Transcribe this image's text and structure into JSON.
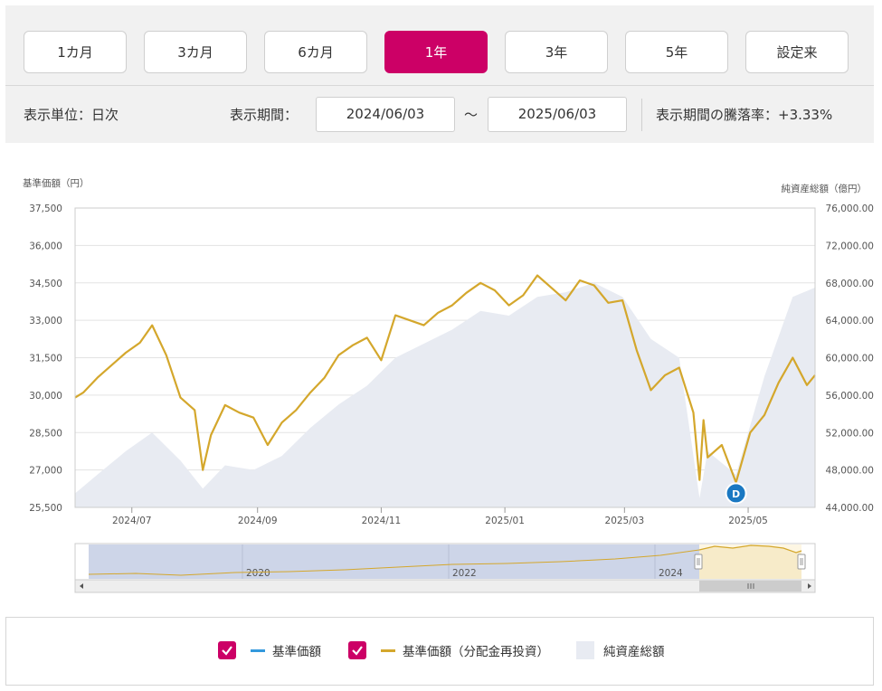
{
  "periods": [
    "1カ月",
    "3カ月",
    "6カ月",
    "1年",
    "3年",
    "5年",
    "設定来"
  ],
  "active_period": "1年",
  "display_unit": "表示単位：日次",
  "display_range_label": "表示期間：",
  "start_date": "2024/06/03",
  "range_sep": "～",
  "end_date": "2025/06/03",
  "change_rate": "表示期間の騰落率：+3.33%",
  "legend": {
    "nav": "基準価額",
    "nav_reinvested": "基準価額（分配金再投資）",
    "net_assets": "純資産総額"
  },
  "colors": {
    "accent": "#cc0066",
    "nav_line": "#3399dd",
    "reinvested_line": "#d4a72c",
    "area": "#e8ebf2",
    "dividend_marker": "#1a78c2"
  },
  "chart_data": {
    "type": "line",
    "left_axis_title": "基準価額（円）",
    "right_axis_title": "純資産総額（億円）",
    "left_ticks": [
      "37,500",
      "36,000",
      "34,500",
      "33,000",
      "31,500",
      "30,000",
      "28,500",
      "27,000",
      "25,500"
    ],
    "right_ticks": [
      "76,000.00",
      "72,000.00",
      "68,000.00",
      "64,000.00",
      "60,000.00",
      "56,000.00",
      "52,000.00",
      "48,000.00",
      "44,000.00"
    ],
    "x_ticks": [
      "2024/07",
      "2024/09",
      "2024/11",
      "2025/01",
      "2025/03",
      "2025/05"
    ],
    "x_tick_positions": [
      "2024-07-01",
      "2024-09-01",
      "2024-11-01",
      "2025-01-01",
      "2025-03-01",
      "2025-05-01"
    ],
    "x_range": [
      "2024-06-03",
      "2025-06-03"
    ],
    "ylim_left": [
      25500,
      37500
    ],
    "ylim_right": [
      44000,
      76000
    ],
    "grid": true,
    "dividend_marker": {
      "date": "2025-04-25",
      "label": "D"
    },
    "series": [
      {
        "name": "基準価額（分配金再投資）",
        "axis": "left",
        "x": [
          "2024-06-03",
          "2024-06-07",
          "2024-06-14",
          "2024-06-21",
          "2024-06-28",
          "2024-07-05",
          "2024-07-11",
          "2024-07-18",
          "2024-07-25",
          "2024-08-01",
          "2024-08-05",
          "2024-08-09",
          "2024-08-16",
          "2024-08-23",
          "2024-08-30",
          "2024-09-06",
          "2024-09-13",
          "2024-09-20",
          "2024-09-27",
          "2024-10-04",
          "2024-10-11",
          "2024-10-18",
          "2024-10-25",
          "2024-11-01",
          "2024-11-08",
          "2024-11-15",
          "2024-11-22",
          "2024-11-29",
          "2024-12-06",
          "2024-12-13",
          "2024-12-20",
          "2024-12-27",
          "2025-01-03",
          "2025-01-10",
          "2025-01-17",
          "2025-01-24",
          "2025-01-31",
          "2025-02-07",
          "2025-02-14",
          "2025-02-21",
          "2025-02-28",
          "2025-03-07",
          "2025-03-14",
          "2025-03-21",
          "2025-03-28",
          "2025-04-04",
          "2025-04-07",
          "2025-04-09",
          "2025-04-11",
          "2025-04-18",
          "2025-04-25",
          "2025-05-02",
          "2025-05-09",
          "2025-05-16",
          "2025-05-23",
          "2025-05-30",
          "2025-06-03"
        ],
        "y": [
          29900,
          30100,
          30700,
          31200,
          31700,
          32100,
          32800,
          31600,
          29900,
          29400,
          27000,
          28400,
          29600,
          29300,
          29100,
          28000,
          28900,
          29400,
          30100,
          30700,
          31600,
          32000,
          32300,
          31400,
          33200,
          33000,
          32800,
          33300,
          33600,
          34100,
          34500,
          34200,
          33600,
          34000,
          34800,
          34300,
          33800,
          34600,
          34400,
          33700,
          33800,
          31800,
          30200,
          30800,
          31100,
          29300,
          26600,
          29000,
          27500,
          28000,
          26500,
          28500,
          29200,
          30500,
          31500,
          30400,
          30800
        ]
      },
      {
        "name": "純資産総額",
        "axis": "right",
        "x": [
          "2024-06-03",
          "2024-06-14",
          "2024-06-28",
          "2024-07-11",
          "2024-07-25",
          "2024-08-05",
          "2024-08-16",
          "2024-08-30",
          "2024-09-13",
          "2024-09-27",
          "2024-10-11",
          "2024-10-25",
          "2024-11-08",
          "2024-11-22",
          "2024-12-06",
          "2024-12-20",
          "2025-01-03",
          "2025-01-17",
          "2025-01-31",
          "2025-02-14",
          "2025-02-28",
          "2025-03-14",
          "2025-03-28",
          "2025-04-07",
          "2025-04-11",
          "2025-04-25",
          "2025-05-09",
          "2025-05-23",
          "2025-06-03"
        ],
        "y": [
          45500,
          47500,
          50000,
          52000,
          49000,
          46000,
          48500,
          48000,
          49500,
          52500,
          55000,
          57000,
          60000,
          61500,
          63000,
          65000,
          64500,
          66500,
          67000,
          68000,
          66500,
          62000,
          60000,
          45000,
          50000,
          47500,
          58000,
          66500,
          67500
        ]
      }
    ]
  },
  "navigator": {
    "year_labels": [
      "2020",
      "2022",
      "2024"
    ]
  }
}
